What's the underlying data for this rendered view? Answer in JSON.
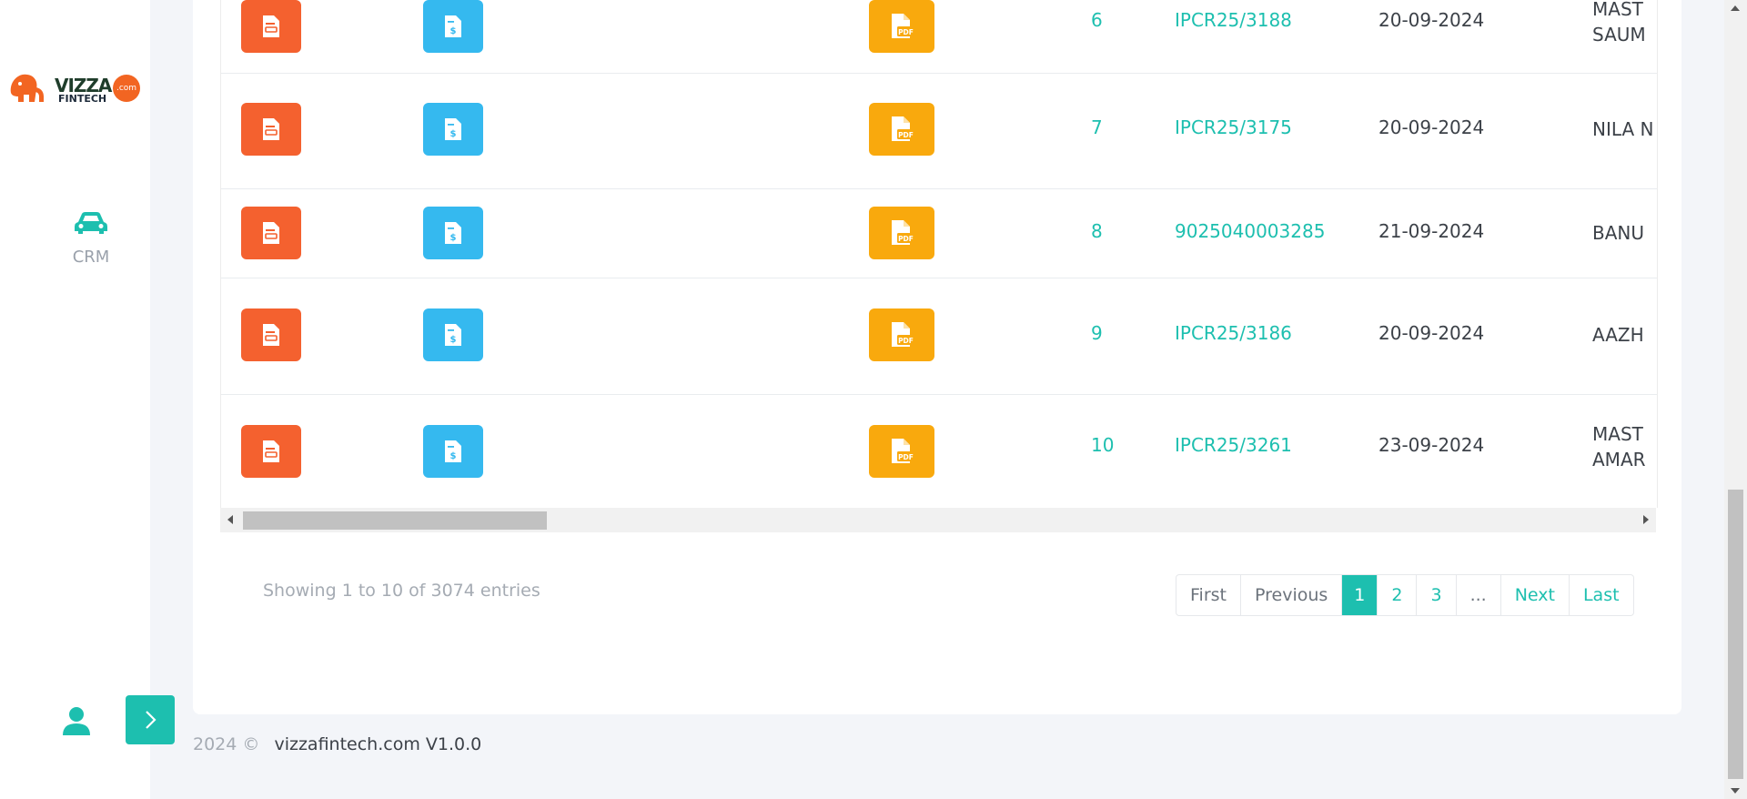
{
  "brand": {
    "logo_name": "VIZZA",
    "logo_sub": "FINTECH",
    "logo_dot": ".com"
  },
  "sidebar": {
    "nav": [
      {
        "label": "CRM",
        "icon": "car-icon"
      }
    ],
    "user_icon": "user-icon",
    "expand_icon": "chevron-right-icon"
  },
  "table": {
    "rows": [
      {
        "no": "6",
        "ref": "IPCR25/3188",
        "date": "20-09-2024",
        "name": "MAST SAUM"
      },
      {
        "no": "7",
        "ref": "IPCR25/3175",
        "date": "20-09-2024",
        "name": "NILA N"
      },
      {
        "no": "8",
        "ref": "9025040003285",
        "date": "21-09-2024",
        "name": "BANU"
      },
      {
        "no": "9",
        "ref": "IPCR25/3186",
        "date": "20-09-2024",
        "name": "AAZH"
      },
      {
        "no": "10",
        "ref": "IPCR25/3261",
        "date": "23-09-2024",
        "name": "MAST AMAR"
      }
    ],
    "row_actions": [
      "edit-document-icon",
      "payment-document-icon",
      "pdf-icon"
    ]
  },
  "info": {
    "showing": "Showing 1 to 10 of 3074 entries"
  },
  "pagination": {
    "first": "First",
    "previous": "Previous",
    "pages": [
      "1",
      "2",
      "3"
    ],
    "ellipsis": "...",
    "next": "Next",
    "last": "Last",
    "active": "1"
  },
  "footer": {
    "year": "2024 ©",
    "site": "vizzafintech.com V1.0.0"
  },
  "colors": {
    "accent": "#1dbfaf",
    "orange": "#f4612f",
    "blue": "#35b9ef",
    "yellow": "#f9a90d"
  }
}
